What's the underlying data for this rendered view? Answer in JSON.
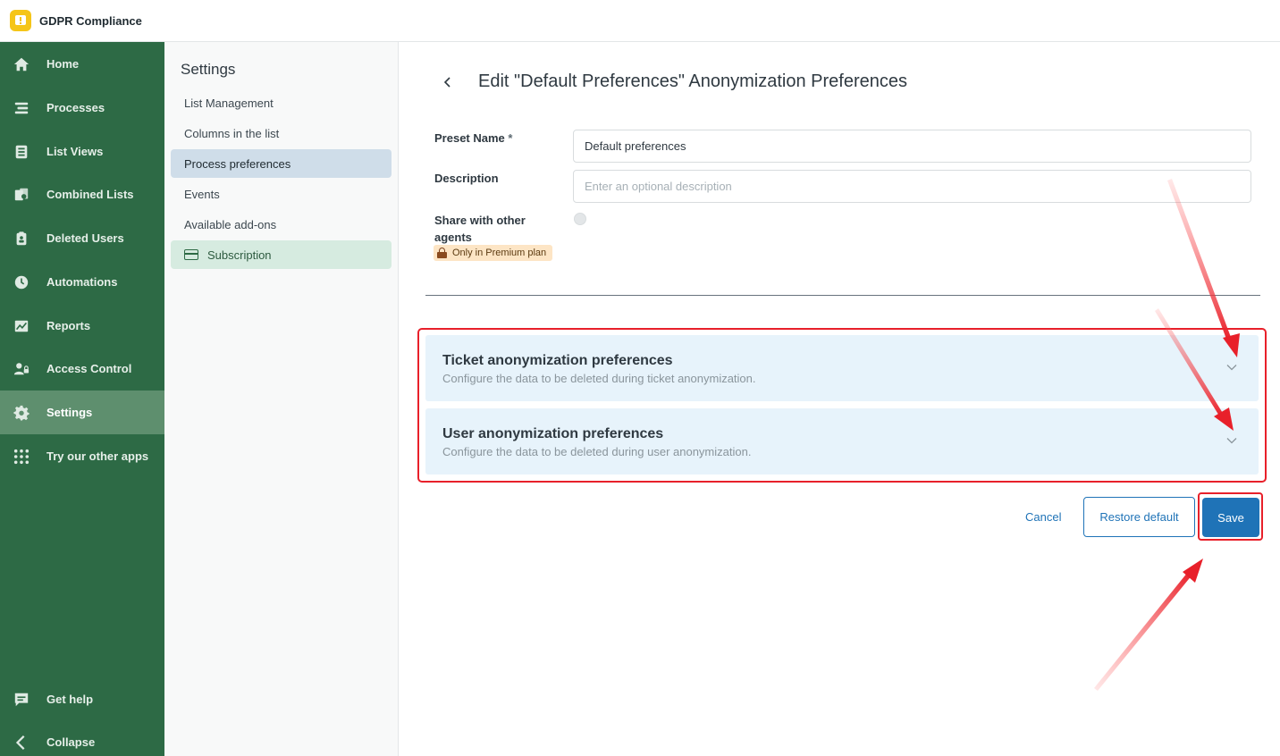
{
  "app": {
    "title": "GDPR Compliance"
  },
  "nav": {
    "items": [
      {
        "label": "Home",
        "icon": "home-icon"
      },
      {
        "label": "Processes",
        "icon": "processes-icon"
      },
      {
        "label": "List Views",
        "icon": "list-views-icon"
      },
      {
        "label": "Combined Lists",
        "icon": "combined-lists-icon"
      },
      {
        "label": "Deleted Users",
        "icon": "deleted-users-icon"
      },
      {
        "label": "Automations",
        "icon": "clock-icon"
      },
      {
        "label": "Reports",
        "icon": "chart-icon"
      },
      {
        "label": "Access Control",
        "icon": "user-lock-icon"
      },
      {
        "label": "Settings",
        "icon": "gear-icon",
        "active": true
      },
      {
        "label": "Try our other apps",
        "icon": "grid-icon"
      }
    ],
    "footer": [
      {
        "label": "Get help",
        "icon": "chat-icon"
      },
      {
        "label": "Collapse",
        "icon": "chevron-left-icon"
      }
    ]
  },
  "settings": {
    "title": "Settings",
    "items": [
      {
        "label": "List Management"
      },
      {
        "label": "Columns in the list"
      },
      {
        "label": "Process preferences",
        "active": true
      },
      {
        "label": "Events"
      },
      {
        "label": "Available add-ons"
      },
      {
        "label": "Subscription",
        "icon": "credit-card-icon"
      }
    ]
  },
  "page": {
    "title": "Edit \"Default Preferences\" Anonymization Preferences",
    "form": {
      "preset_name_label": "Preset Name",
      "preset_name_required": "*",
      "preset_name_value": "Default preferences",
      "description_label": "Description",
      "description_placeholder": "Enter an optional description",
      "share_label": "Share with other agents",
      "share_enabled": false,
      "premium_badge": "Only in Premium plan"
    },
    "sections": [
      {
        "title": "Ticket anonymization preferences",
        "description": "Configure the data to be deleted during ticket anonymization."
      },
      {
        "title": "User anonymization preferences",
        "description": "Configure the data to be deleted during user anonymization."
      }
    ],
    "actions": {
      "cancel": "Cancel",
      "restore_default": "Restore default",
      "save": "Save"
    }
  },
  "colors": {
    "nav_bg": "#2d6a45",
    "nav_active": "#5e8f6e",
    "primary": "#1f73b7",
    "accordion_bg": "#e7f3fb",
    "annotation_red": "#e8202a"
  }
}
